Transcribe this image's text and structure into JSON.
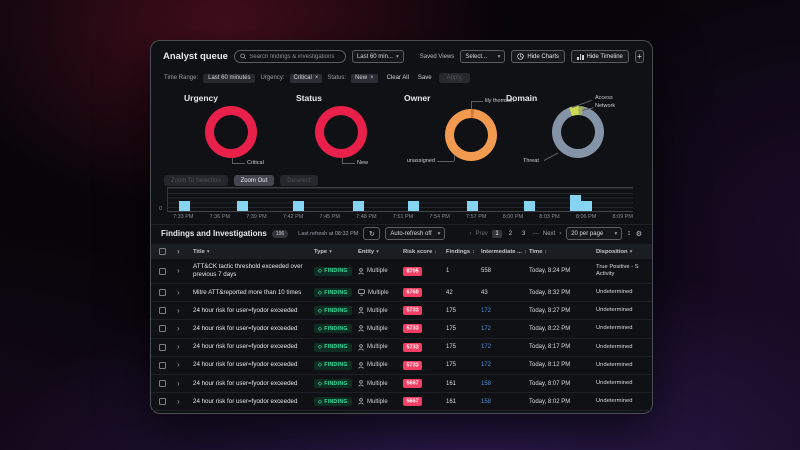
{
  "glyphs": {
    "caret": "▾",
    "close": "×",
    "refresh": "↻",
    "gear": "⚙",
    "sliders": "↕",
    "prev_chevron": "‹",
    "next_chevron": "›",
    "expand": "›",
    "diamond": "◇"
  },
  "titlebar": {
    "title": "Analyst queue",
    "search_placeholder": "Search findings & investigations",
    "time_range_dropdown": "Last 60 min...",
    "saved_views_label": "Saved Views",
    "saved_views_value": "Select...",
    "hide_charts": "Hide Charts",
    "hide_timeline": "Hide Timeline",
    "add_button": "+"
  },
  "filterbar": {
    "time_range_label": "Time Range:",
    "time_range_value": "Last 60 minutes",
    "urgency_label": "Urgency:",
    "urgency_value": "Critical",
    "status_label": "Status:",
    "status_value": "New",
    "clear_all": "Clear All",
    "save": "Save",
    "apply": "Apply"
  },
  "chart_data": [
    {
      "type": "pie",
      "title": "Urgency",
      "slices": [
        {
          "label": "Critical",
          "value": 100,
          "color": "#e8204a"
        }
      ],
      "start_deg": 0
    },
    {
      "type": "pie",
      "title": "Status",
      "slices": [
        {
          "label": "New",
          "value": 100,
          "color": "#e8204a"
        }
      ],
      "start_deg": 0
    },
    {
      "type": "pie",
      "title": "Owner",
      "slices": [
        {
          "label": "lily thomson",
          "value": 2,
          "color": "#d27a38"
        },
        {
          "label": "unassigned",
          "value": 98,
          "color": "#f29a50"
        }
      ],
      "start_deg": 0
    },
    {
      "type": "pie",
      "title": "Domain",
      "slices": [
        {
          "label": "Access",
          "value": 6,
          "color": "#cdd955"
        },
        {
          "label": "Network",
          "value": 3,
          "color": "#9fb25c"
        },
        {
          "label": "Threat",
          "value": 91,
          "color": "#8494a6"
        }
      ],
      "start_deg": -20
    }
  ],
  "timeline": {
    "buttons": [
      {
        "label": "Zoom To Selection",
        "enabled": false
      },
      {
        "label": "Zoom Out",
        "enabled": true
      },
      {
        "label": "Deselect",
        "enabled": false
      }
    ],
    "y_axis_zero": "0",
    "bar_color": "#85d5f2",
    "ticks": [
      "7:33 PM",
      "7:36 PM",
      "7:39 PM",
      "7:42 PM",
      "7:45 PM",
      "7:48 PM",
      "7:51 PM",
      "7:54 PM",
      "7:57 PM",
      "8:00 PM",
      "8:03 PM",
      "8:06 PM",
      "8:09 PM"
    ],
    "bars": [
      {
        "x_pct": 2.4,
        "count": 1
      },
      {
        "x_pct": 14.9,
        "count": 1
      },
      {
        "x_pct": 26.9,
        "count": 1
      },
      {
        "x_pct": 39.7,
        "count": 1
      },
      {
        "x_pct": 51.7,
        "count": 1
      },
      {
        "x_pct": 64.4,
        "count": 1
      },
      {
        "x_pct": 76.5,
        "count": 1
      },
      {
        "x_pct": 86.4,
        "count": 2
      },
      {
        "x_pct": 88.9,
        "count": 1
      }
    ]
  },
  "table": {
    "title": "Findings and Investigations",
    "count_badge": "196",
    "last_refresh": "Last refresh at 08:32 PM",
    "auto_refresh": "Auto-refresh off",
    "pagination": {
      "prev": "Prev",
      "pages": [
        "1",
        "2",
        "3"
      ],
      "ellipsis": "—",
      "next": "Next",
      "active": "1"
    },
    "page_size": "20 per page",
    "columns": [
      {
        "label": "Title",
        "sort": "▾"
      },
      {
        "label": "Type",
        "sort": "▾"
      },
      {
        "label": "Entity",
        "sort": "▾"
      },
      {
        "label": "Risk score",
        "sort": "↓"
      },
      {
        "label": "Findings",
        "sort": "↕"
      },
      {
        "label": "Intermediate ...",
        "sort": "↕"
      },
      {
        "label": "Time",
        "sort": "↕"
      },
      {
        "label": "Disposition",
        "sort": "▾"
      }
    ],
    "rows": [
      {
        "title": "ATT&CK tactic threshold exceeded over previous 7 days",
        "type": "FINDING",
        "entity": "Multiple",
        "entity_icon": "person",
        "risk": "8705",
        "findings": "1",
        "intermediate": "558",
        "intermediate_link": false,
        "time": "Today, 8:24 PM",
        "disposition_line1": "True Positive - S",
        "disposition_line2": "Activity"
      },
      {
        "title": "Mitre ATT&reported more than 10 times",
        "type": "FINDING",
        "entity": "Multiple",
        "entity_icon": "monitor",
        "risk": "6760",
        "findings": "42",
        "intermediate": "43",
        "intermediate_link": false,
        "time": "Today, 8:32 PM",
        "disposition_line1": "Undetermined",
        "disposition_line2": ""
      },
      {
        "title": "24 hour risk for user=fyodor exceeded",
        "type": "FINDING",
        "entity": "Multiple",
        "entity_icon": "person",
        "risk": "5733",
        "findings": "175",
        "intermediate": "172",
        "intermediate_link": true,
        "time": "Today, 8:27 PM",
        "disposition_line1": "Undetermined",
        "disposition_line2": ""
      },
      {
        "title": "24 hour risk for user=fyodor exceeded",
        "type": "FINDING",
        "entity": "Multiple",
        "entity_icon": "person",
        "risk": "5733",
        "findings": "175",
        "intermediate": "172",
        "intermediate_link": true,
        "time": "Today, 8:22 PM",
        "disposition_line1": "Undetermined",
        "disposition_line2": ""
      },
      {
        "title": "24 hour risk for user=fyodor exceeded",
        "type": "FINDING",
        "entity": "Multiple",
        "entity_icon": "person",
        "risk": "5733",
        "findings": "175",
        "intermediate": "172",
        "intermediate_link": true,
        "time": "Today, 8:17 PM",
        "disposition_line1": "Undetermined",
        "disposition_line2": ""
      },
      {
        "title": "24 hour risk for user=fyodor exceeded",
        "type": "FINDING",
        "entity": "Multiple",
        "entity_icon": "person",
        "risk": "5733",
        "findings": "175",
        "intermediate": "172",
        "intermediate_link": true,
        "time": "Today, 8:12 PM",
        "disposition_line1": "Undetermined",
        "disposition_line2": ""
      },
      {
        "title": "24 hour risk for user=fyodor exceeded",
        "type": "FINDING",
        "entity": "Multiple",
        "entity_icon": "person",
        "risk": "5667",
        "findings": "161",
        "intermediate": "158",
        "intermediate_link": true,
        "time": "Today, 8:07 PM",
        "disposition_line1": "Undetermined",
        "disposition_line2": ""
      },
      {
        "title": "24 hour risk for user=fyodor exceeded",
        "type": "FINDING",
        "entity": "Multiple",
        "entity_icon": "person",
        "risk": "5667",
        "findings": "161",
        "intermediate": "158",
        "intermediate_link": true,
        "time": "Today, 8:02 PM",
        "disposition_line1": "Undetermined",
        "disposition_line2": ""
      }
    ]
  }
}
